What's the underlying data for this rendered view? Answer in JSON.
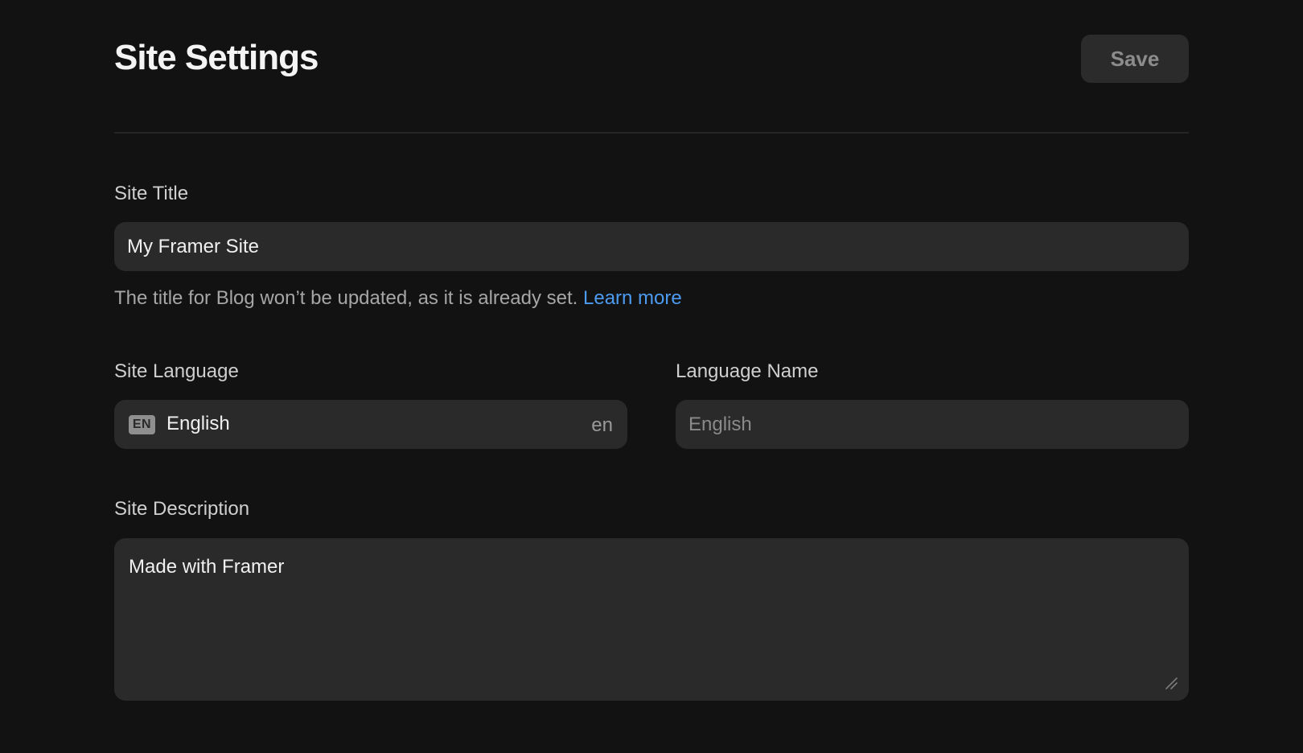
{
  "header": {
    "title": "Site Settings",
    "save_label": "Save"
  },
  "site_title": {
    "label": "Site Title",
    "value": "My Framer Site",
    "hint_text": "The title for Blog won’t be updated, as it is already set.",
    "hint_link": "Learn more"
  },
  "site_language": {
    "label": "Site Language",
    "flag": "EN",
    "selected": "English",
    "code": "en"
  },
  "language_name": {
    "label": "Language Name",
    "placeholder": "English"
  },
  "site_description": {
    "label": "Site Description",
    "value": "Made with Framer"
  },
  "colors": {
    "background": "#121212",
    "field": "#2a2a2a",
    "link": "#4d9bf0"
  }
}
